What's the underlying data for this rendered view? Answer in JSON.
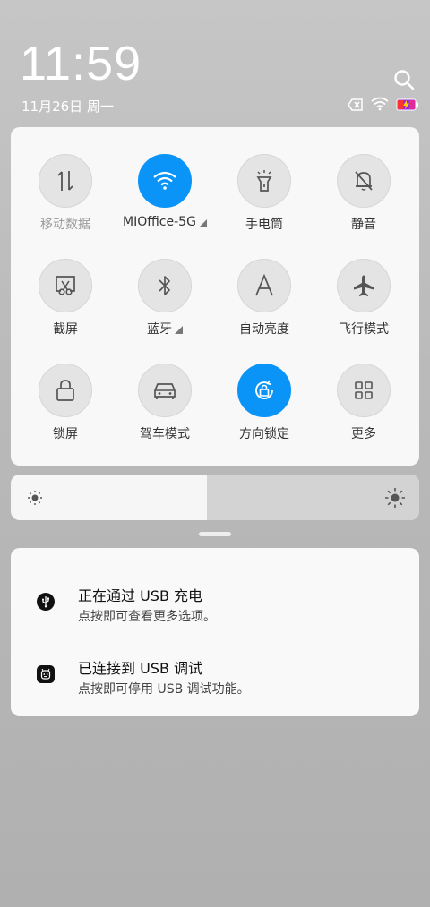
{
  "header": {
    "time": "11:59",
    "date": "11月26日 周一",
    "search_icon": "search-icon",
    "status_icons": [
      "no-sim-icon",
      "wifi-icon",
      "battery-charging-icon"
    ]
  },
  "quick_settings": {
    "tiles": [
      {
        "label": "移动数据",
        "icon": "mobile-data-icon",
        "active": false,
        "dim": true,
        "expandable": false
      },
      {
        "label": "MIOffice-5G",
        "icon": "wifi-icon",
        "active": true,
        "dim": false,
        "expandable": true
      },
      {
        "label": "手电筒",
        "icon": "flashlight-icon",
        "active": false,
        "dim": false,
        "expandable": false
      },
      {
        "label": "静音",
        "icon": "mute-bell-icon",
        "active": false,
        "dim": false,
        "expandable": false
      },
      {
        "label": "截屏",
        "icon": "screenshot-icon",
        "active": false,
        "dim": false,
        "expandable": false
      },
      {
        "label": "蓝牙",
        "icon": "bluetooth-icon",
        "active": false,
        "dim": false,
        "expandable": true
      },
      {
        "label": "自动亮度",
        "icon": "auto-brightness-icon",
        "active": false,
        "dim": false,
        "expandable": false
      },
      {
        "label": "飞行模式",
        "icon": "airplane-icon",
        "active": false,
        "dim": false,
        "expandable": false
      },
      {
        "label": "锁屏",
        "icon": "lock-icon",
        "active": false,
        "dim": false,
        "expandable": false
      },
      {
        "label": "驾车模式",
        "icon": "car-icon",
        "active": false,
        "dim": false,
        "expandable": false
      },
      {
        "label": "方向锁定",
        "icon": "rotation-lock-icon",
        "active": true,
        "dim": false,
        "expandable": false
      },
      {
        "label": "更多",
        "icon": "grid-icon",
        "active": false,
        "dim": false,
        "expandable": false
      }
    ]
  },
  "brightness": {
    "level": 0.48,
    "min_icon": "sun-small-icon",
    "max_icon": "sun-large-icon"
  },
  "notifications": [
    {
      "title": "正在通过 USB 充电",
      "subtitle": "点按即可查看更多选项。",
      "icon": "usb-icon"
    },
    {
      "title": "已连接到 USB 调试",
      "subtitle": "点按即可停用 USB 调试功能。",
      "icon": "android-debug-icon"
    }
  ],
  "colors": {
    "accent": "#0a94f8",
    "panel": "#f8f8f8",
    "tile_inactive": "#e4e4e4"
  }
}
